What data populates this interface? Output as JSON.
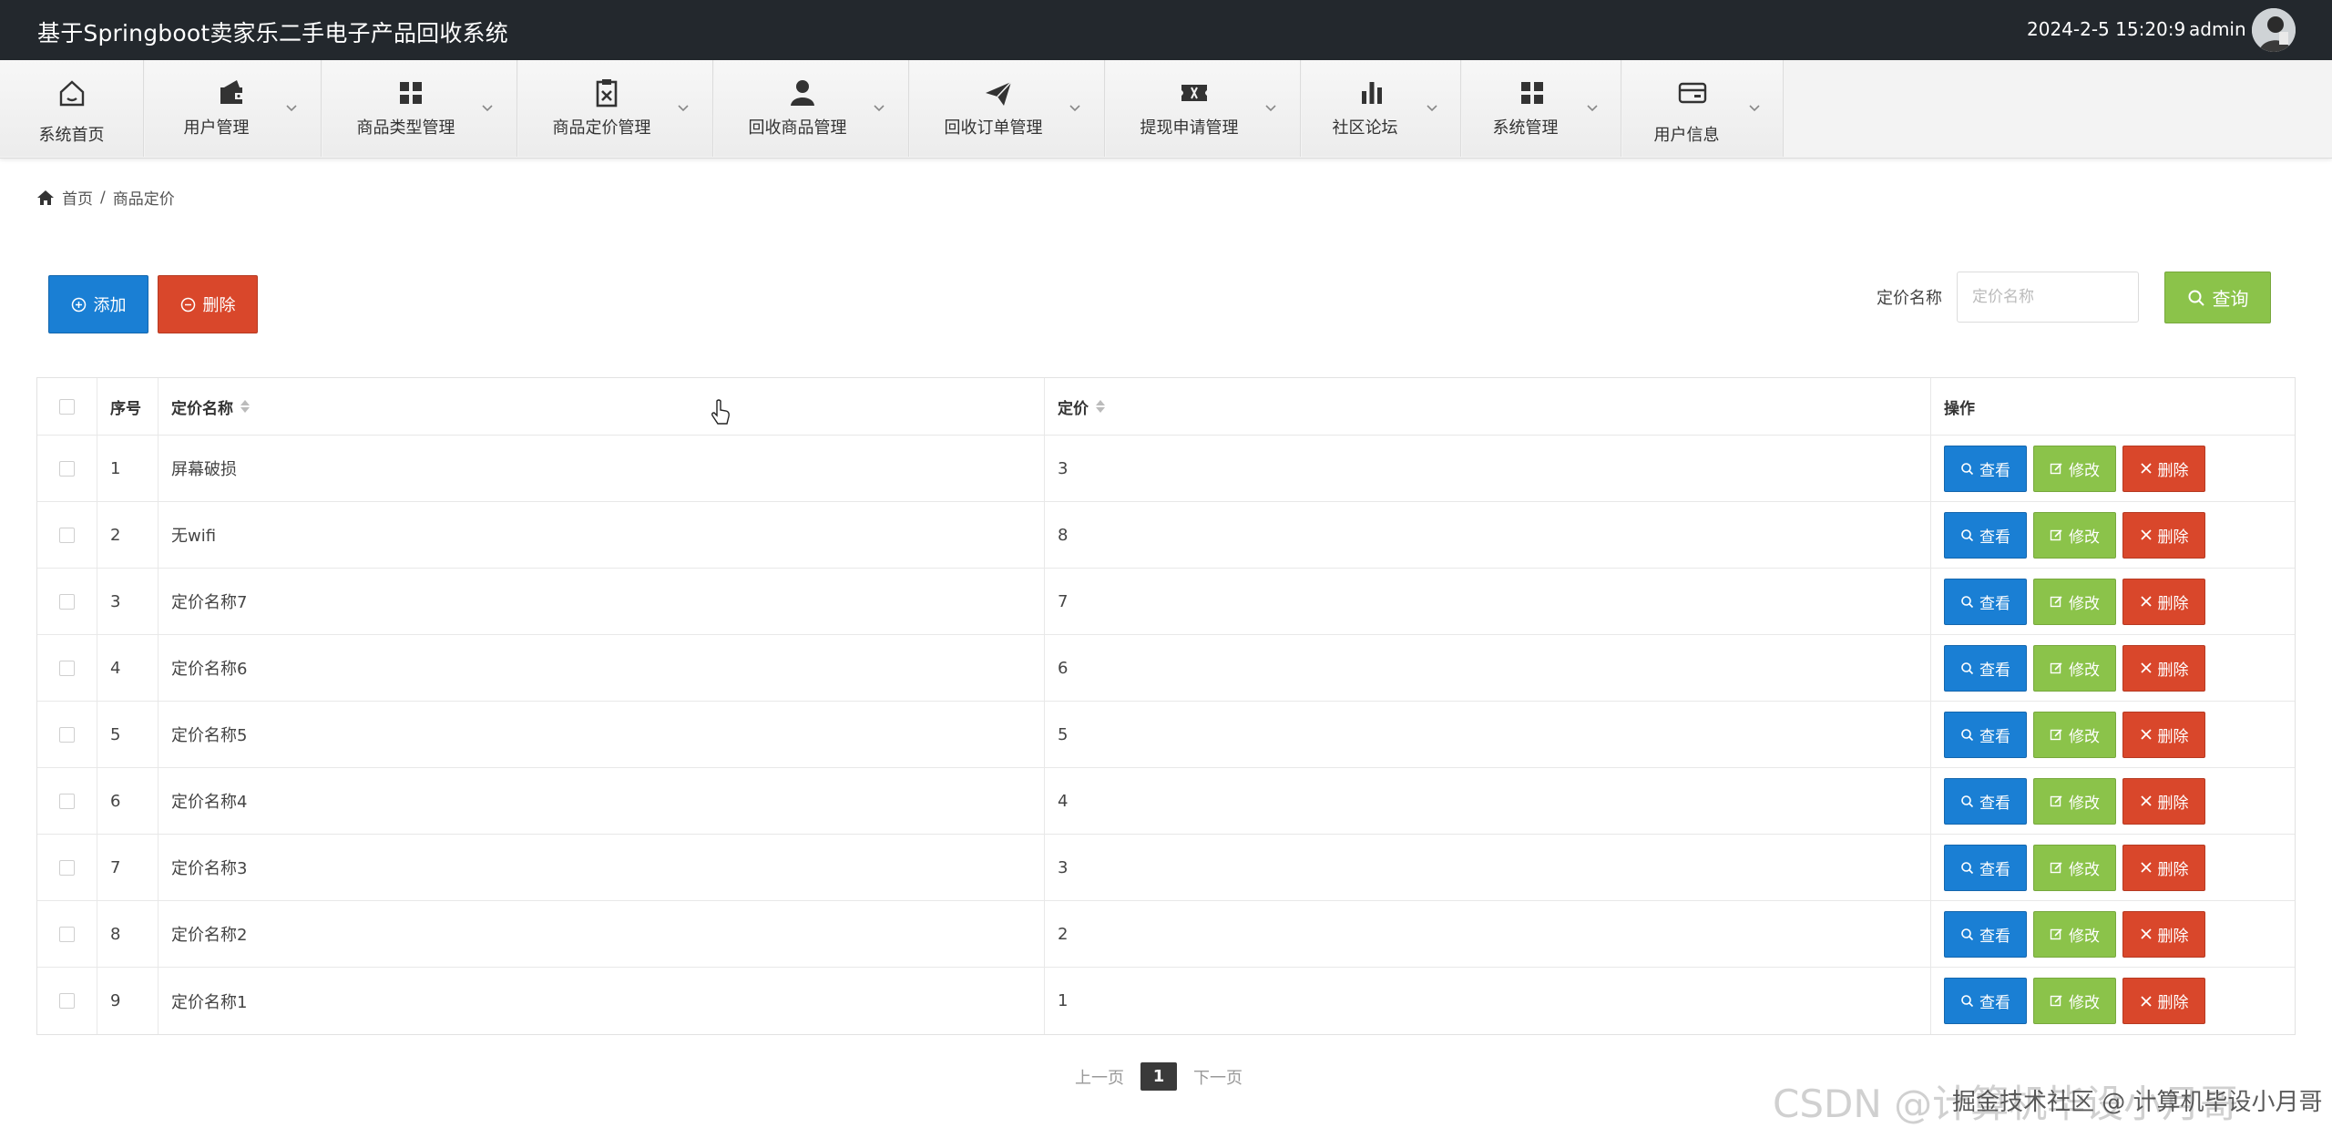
{
  "header": {
    "title": "基于Springboot卖家乐二手电子产品回收系统",
    "datetime": "2024-2-5 15:20:9",
    "username": "admin"
  },
  "nav": {
    "items": [
      {
        "label": "系统首页",
        "icon": "home-icon"
      },
      {
        "label": "用户管理",
        "icon": "wallet-icon"
      },
      {
        "label": "商品类型管理",
        "icon": "grid-icon"
      },
      {
        "label": "商品定价管理",
        "icon": "clipboard-icon"
      },
      {
        "label": "回收商品管理",
        "icon": "user-icon"
      },
      {
        "label": "回收订单管理",
        "icon": "paper-plane-icon"
      },
      {
        "label": "提现申请管理",
        "icon": "ticket-icon"
      },
      {
        "label": "社区论坛",
        "icon": "bar-chart-icon"
      },
      {
        "label": "系统管理",
        "icon": "grid-icon"
      },
      {
        "label": "用户信息",
        "icon": "card-icon"
      }
    ]
  },
  "breadcrumb": {
    "home": "首页",
    "separator": "/",
    "current": "商品定价"
  },
  "toolbar": {
    "add_label": "添加",
    "delete_label": "删除",
    "search_label": "定价名称",
    "search_placeholder": "定价名称",
    "search_value": "",
    "query_label": "查询"
  },
  "table": {
    "columns": {
      "index": "序号",
      "name": "定价名称",
      "price": "定价",
      "ops": "操作"
    },
    "op_labels": {
      "view": "查看",
      "edit": "修改",
      "delete": "删除"
    },
    "rows": [
      {
        "index": "1",
        "name": "屏幕破损",
        "price": "3"
      },
      {
        "index": "2",
        "name": "无wifi",
        "price": "8"
      },
      {
        "index": "3",
        "name": "定价名称7",
        "price": "7"
      },
      {
        "index": "4",
        "name": "定价名称6",
        "price": "6"
      },
      {
        "index": "5",
        "name": "定价名称5",
        "price": "5"
      },
      {
        "index": "6",
        "name": "定价名称4",
        "price": "4"
      },
      {
        "index": "7",
        "name": "定价名称3",
        "price": "3"
      },
      {
        "index": "8",
        "name": "定价名称2",
        "price": "2"
      },
      {
        "index": "9",
        "name": "定价名称1",
        "price": "1"
      }
    ]
  },
  "pagination": {
    "prev": "上一页",
    "current": "1",
    "next": "下一页"
  },
  "watermark": {
    "main": "CSDN @计算机毕设小月哥",
    "overlay": "掘金技术社区 @ 计算机毕设小月哥"
  },
  "colors": {
    "header_bg": "#23282d",
    "primary": "#1a7fd4",
    "success": "#8bc34a",
    "danger": "#d9472b"
  }
}
